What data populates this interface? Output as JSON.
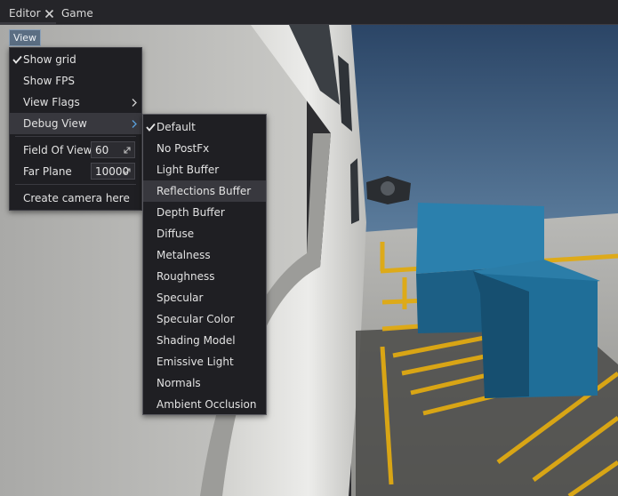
{
  "tabs": {
    "editor": "Editor",
    "game": "Game"
  },
  "viewport": {
    "view_button": "View"
  },
  "view_menu": {
    "items": [
      {
        "label": "Show grid",
        "checked": true
      },
      {
        "label": "Show FPS"
      },
      {
        "label": "View Flags",
        "submenu": true
      },
      {
        "label": "Debug View",
        "submenu": true,
        "open": true
      },
      {
        "label": "Field Of View",
        "value": "60"
      },
      {
        "label": "Far Plane",
        "value": "10000"
      },
      {
        "label": "Create camera here"
      }
    ]
  },
  "debug_view_menu": {
    "items": [
      {
        "label": "Default",
        "checked": true
      },
      {
        "label": "No PostFx"
      },
      {
        "label": "Light Buffer"
      },
      {
        "label": "Reflections Buffer",
        "hovered": true
      },
      {
        "label": "Depth Buffer"
      },
      {
        "label": "Diffuse"
      },
      {
        "label": "Metalness"
      },
      {
        "label": "Roughness"
      },
      {
        "label": "Specular"
      },
      {
        "label": "Specular Color"
      },
      {
        "label": "Shading Model"
      },
      {
        "label": "Emissive Light"
      },
      {
        "label": "Normals"
      },
      {
        "label": "Ambient Occlusion"
      }
    ]
  },
  "colors": {
    "menu_bg": "#1f1f23",
    "highlight": "#38383e",
    "view_button": "#5b6e83",
    "accent_yellow": "#e0aa12",
    "cube_blue": "#1f6e98"
  }
}
